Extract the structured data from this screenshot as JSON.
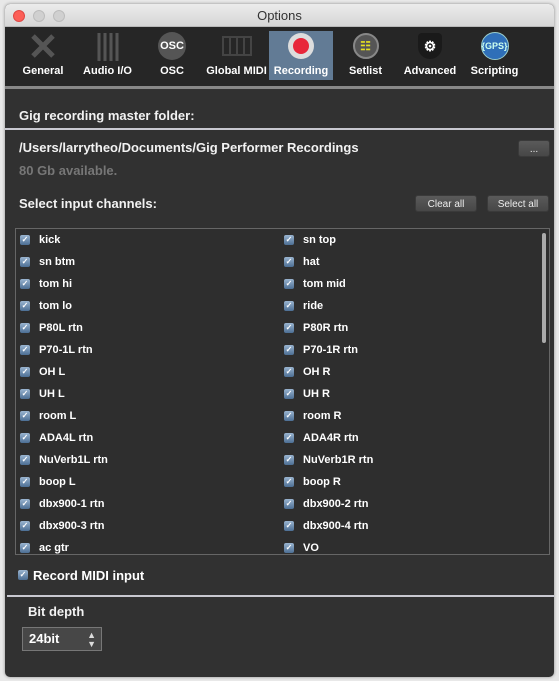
{
  "window": {
    "title": "Options"
  },
  "tabs": [
    {
      "label": "General",
      "icon": "wrench-screwdriver-icon"
    },
    {
      "label": "Audio I/O",
      "icon": "faders-icon"
    },
    {
      "label": "OSC",
      "icon": "osc-icon",
      "icon_text": "OSC"
    },
    {
      "label": "Global MIDI",
      "icon": "keyboard-icon"
    },
    {
      "label": "Recording",
      "icon": "record-icon",
      "selected": true
    },
    {
      "label": "Setlist",
      "icon": "setlist-icon"
    },
    {
      "label": "Advanced",
      "icon": "gear-shield-icon"
    },
    {
      "label": "Scripting",
      "icon": "gps-icon",
      "icon_text": "{GPS}"
    }
  ],
  "recording": {
    "folder_heading": "Gig recording master folder:",
    "folder_path": "/Users/larrytheo/Documents/Gig Performer Recordings",
    "browse_label": "...",
    "available": "80 Gb available.",
    "channels_heading": "Select input channels:",
    "clear_all": "Clear all",
    "select_all": "Select all",
    "channels": [
      [
        "kick",
        "sn top"
      ],
      [
        "sn btm",
        "hat"
      ],
      [
        "tom hi",
        "tom mid"
      ],
      [
        "tom lo",
        "ride"
      ],
      [
        "P80L rtn",
        "P80R rtn"
      ],
      [
        "P70-1L rtn",
        "P70-1R rtn"
      ],
      [
        "OH L",
        "OH R"
      ],
      [
        "UH L",
        "UH R"
      ],
      [
        "room L",
        "room R"
      ],
      [
        "ADA4L rtn",
        "ADA4R rtn"
      ],
      [
        "NuVerb1L rtn",
        "NuVerb1R rtn"
      ],
      [
        "boop L",
        "boop R"
      ],
      [
        "dbx900-1 rtn",
        "dbx900-2 rtn"
      ],
      [
        "dbx900-3 rtn",
        "dbx900-4 rtn"
      ],
      [
        "ac gtr",
        "VO"
      ]
    ],
    "record_midi_label": "Record MIDI input",
    "record_midi_checked": true,
    "bit_depth_label": "Bit depth",
    "bit_depth_value": "24bit"
  },
  "colors": {
    "selected_tab": "#627b95",
    "close": "#fc5f57"
  }
}
